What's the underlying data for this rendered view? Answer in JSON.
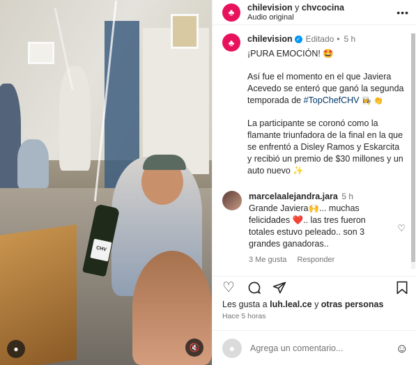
{
  "header": {
    "account1": "chilevision",
    "connector": "y",
    "account2": "chvcocina",
    "audio": "Audio original",
    "more_icon": "more-dots-icon"
  },
  "post": {
    "username": "chilevision",
    "edited": "Editado",
    "bullet": "•",
    "time": "5 h",
    "line1": "¡PURA EMOCIÓN! 🤩",
    "para2_text": "Así fue el momento en el que Javiera Acevedo se enteró que ganó la segunda temporada de ",
    "hashtag": "#TopChefCHV",
    "para2_emoji": "👩‍🍳 👏",
    "para3": "La participante se coronó como la flamante triunfadora de la final en la que se enfrentó a Disley Ramos y Eskarcita y recibió un premio de $30 millones y un auto nuevo ✨"
  },
  "comment": {
    "username": "marcelaalejandra.jara",
    "time": "5 h",
    "text": "Grande Javiera🙌... muchas felicidades ❤️.. las tres fueron totales estuvo peleado.. son 3 grandes ganadoras..",
    "likes": "3 Me gusta",
    "reply": "Responder"
  },
  "actions": {
    "like_icon": "heart-icon",
    "comment_icon": "comment-icon",
    "share_icon": "send-icon",
    "save_icon": "bookmark-icon"
  },
  "likes": {
    "prefix": "Les gusta a",
    "user": "luh.leal.ce",
    "middle": "y",
    "others": "otras personas"
  },
  "timestamp": "Hace 5 horas",
  "add_comment": {
    "placeholder": "Agrega un comentario..."
  },
  "media": {
    "bottle_label": "CHV"
  }
}
